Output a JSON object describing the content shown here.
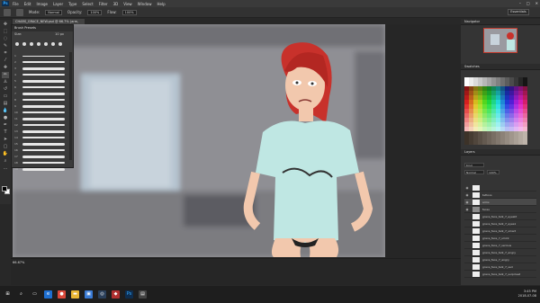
{
  "app": {
    "logo": "Ps"
  },
  "menubar": {
    "items": [
      "File",
      "Edit",
      "Image",
      "Layer",
      "Type",
      "Select",
      "Filter",
      "3D",
      "View",
      "Window",
      "Help"
    ],
    "window_controls": [
      "–",
      "□",
      "✕"
    ]
  },
  "options": {
    "mode_label": "Mode:",
    "mode_value": "Normal",
    "opacity_label": "Opacity:",
    "opacity_value": "100%",
    "flow_label": "Flow:",
    "flow_value": "100%",
    "workspace": "Essentials"
  },
  "document": {
    "tab_title": "CHARS_GRACE_NEW.psd @ 66.7% (arm, RGB/8)",
    "zoom": "66.67%"
  },
  "brush_panel": {
    "title": "Brush Presets",
    "size_label": "Size:",
    "size_value": "10 px",
    "strokes": [
      "1",
      "2",
      "3",
      "4",
      "5",
      "6",
      "7",
      "8",
      "9",
      "10",
      "11",
      "12",
      "13",
      "14",
      "15",
      "16",
      "17",
      "18",
      "19"
    ]
  },
  "right_panels": {
    "navigator": "Navigator",
    "swatches": "Swatches",
    "layers": "Layers"
  },
  "layers": {
    "kind_label": "Kind",
    "blend": "Normal",
    "opacity": "100%",
    "rows": [
      {
        "name": "",
        "selected": false
      },
      {
        "name": "tattoos",
        "selected": false
      },
      {
        "name": "arms",
        "selected": true
      },
      {
        "name": "faces",
        "selected": false
      },
      {
        "name": "grace_face_talk_7_eyeslit",
        "selected": false
      },
      {
        "name": "grace_face_talk_7_eyes1",
        "selected": false
      },
      {
        "name": "grace_face_talk_7_smart",
        "selected": false
      },
      {
        "name": "grace_face_7_smirk",
        "selected": false
      },
      {
        "name": "grace_face_7_serious",
        "selected": false
      },
      {
        "name": "grace_face_talk_7_angry",
        "selected": false
      },
      {
        "name": "grace_face_7_angry",
        "selected": false
      },
      {
        "name": "grace_face_talk_7_sad",
        "selected": false
      },
      {
        "name": "grace_face_talk_7_surprised",
        "selected": false
      }
    ]
  },
  "taskbar": {
    "time": "3:45 PM",
    "date": "2018-07-08"
  },
  "colors": {
    "accent": "#31a8ff",
    "canvas_bg": "#9a9a9e",
    "shirt": "#bfe7e3",
    "hair": "#c8312b"
  }
}
